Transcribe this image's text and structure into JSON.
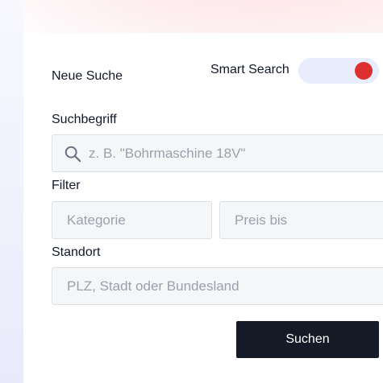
{
  "form": {
    "title": "Neue Suche",
    "smart_search": {
      "label": "Smart Search",
      "enabled": true,
      "knob_color": "#dc2f2f",
      "track_color": "#e9ecfb"
    },
    "search": {
      "label": "Suchbegriff",
      "placeholder": "z. B. \"Bohrmaschine 18V\"",
      "value": "",
      "icon": "search-icon"
    },
    "filter": {
      "label": "Filter",
      "category_placeholder": "Kategorie",
      "price_placeholder": "Preis bis"
    },
    "location": {
      "label": "Standort",
      "placeholder": "PLZ, Stadt oder Bundesland"
    },
    "submit_label": "Suchen",
    "submit_color": "#141a26"
  }
}
